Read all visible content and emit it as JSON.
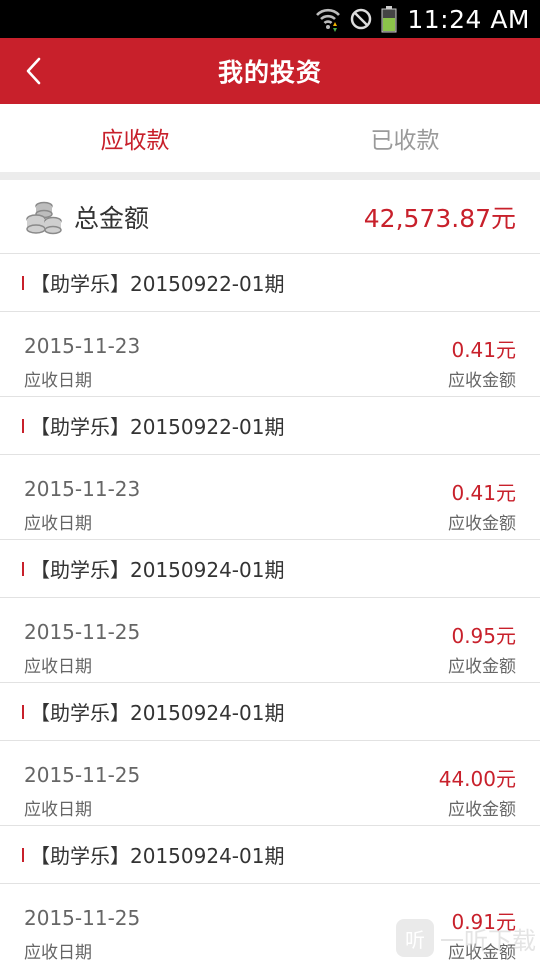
{
  "status_bar": {
    "time": "11:24 AM",
    "icons": [
      "wifi-icon",
      "blocked-icon",
      "battery-icon"
    ]
  },
  "header": {
    "title": "我的投资",
    "back_icon": "chevron-left-icon"
  },
  "tabs": [
    {
      "label": "应收款",
      "active": true
    },
    {
      "label": "已收款",
      "active": false
    }
  ],
  "summary": {
    "icon": "coins-icon",
    "label": "总金额",
    "value": "42,573.87元"
  },
  "items": [
    {
      "name": "【助学乐】20150922-01期",
      "date": "2015-11-23",
      "date_label": "应收日期",
      "amount": "0.41元",
      "amount_label": "应收金额"
    },
    {
      "name": "【助学乐】20150922-01期",
      "date": "2015-11-23",
      "date_label": "应收日期",
      "amount": "0.41元",
      "amount_label": "应收金额"
    },
    {
      "name": "【助学乐】20150924-01期",
      "date": "2015-11-25",
      "date_label": "应收日期",
      "amount": "0.95元",
      "amount_label": "应收金额"
    },
    {
      "name": "【助学乐】20150924-01期",
      "date": "2015-11-25",
      "date_label": "应收日期",
      "amount": "44.00元",
      "amount_label": "应收金额"
    },
    {
      "name": "【助学乐】20150924-01期",
      "date": "2015-11-25",
      "date_label": "应收日期",
      "amount": "0.91元",
      "amount_label": "应收金额"
    }
  ],
  "watermark": {
    "badge": "听",
    "text": "一听下载"
  },
  "colors": {
    "brand_red": "#c8202b",
    "inactive_tab": "#9a9a9a"
  }
}
